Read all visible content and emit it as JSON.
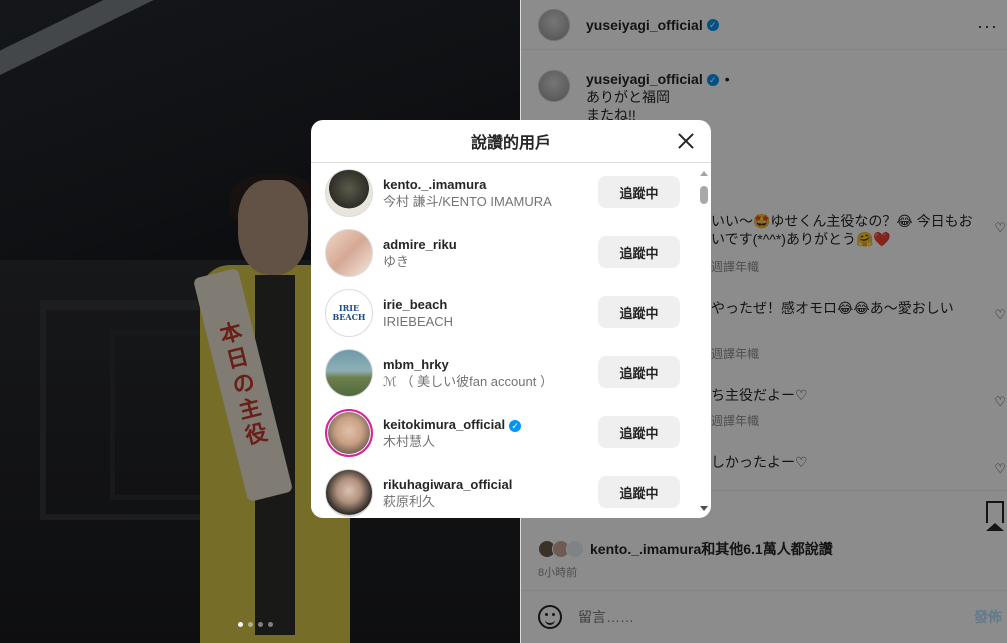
{
  "post": {
    "author": "yuseiyagi_official",
    "caption_author": "yuseiyagi_official",
    "caption_line1": "ありがと福岡",
    "caption_line2": "またね!!",
    "likes_text": "kento._.imamura和其他6.1萬人都說讚",
    "time_ago": "8小時前",
    "comment_placeholder": "留言……",
    "post_label": "發佈",
    "more_label": "···"
  },
  "comments": [
    {
      "text_line1": "いい〜🤩ゆせくん主役なの？😂 今日もお",
      "text_line2": "いです(*^^*)ありがとう🤗❤️",
      "meta": "週譯年幟"
    },
    {
      "text_line1": "やったぜ！感オモロ😂😂あ〜愛おしい",
      "text_line2": "",
      "meta": "週譯年幟"
    },
    {
      "text_line1": "ち主役だよー♡",
      "text_line2": "",
      "meta": "週譯年幟"
    },
    {
      "text_line1": "しかったよー♡",
      "text_line2": "",
      "meta": ""
    }
  ],
  "modal": {
    "title": "說讚的用戶",
    "users": [
      {
        "handle": "kento._.imamura",
        "name": "今村 謙斗/KENTO IMAMURA",
        "button": "追蹤中",
        "verified": false
      },
      {
        "handle": "admire_riku",
        "name": "ゆき",
        "button": "追蹤中",
        "verified": false
      },
      {
        "handle": "irie_beach",
        "name": "IRIEBEACH",
        "button": "追蹤中",
        "verified": false,
        "logo_text": "IRIE BEACH"
      },
      {
        "handle": "mbm_hrky",
        "name": "ℳ （ 美しい彼fan account ）",
        "button": "追蹤中",
        "verified": false
      },
      {
        "handle": "keitokimura_official",
        "name": "木村慧人",
        "button": "追蹤中",
        "verified": true
      },
      {
        "handle": "rikuhagiwara_official",
        "name": "萩原利久",
        "button": "追蹤中",
        "verified": false
      }
    ]
  },
  "photo": {
    "sash_text": "本日の主役",
    "carousel_dots": 4,
    "active_dot": 0
  },
  "colors": {
    "verified": "#0095f6",
    "button_bg": "#efefef",
    "text": "#262626",
    "muted": "#737373"
  }
}
